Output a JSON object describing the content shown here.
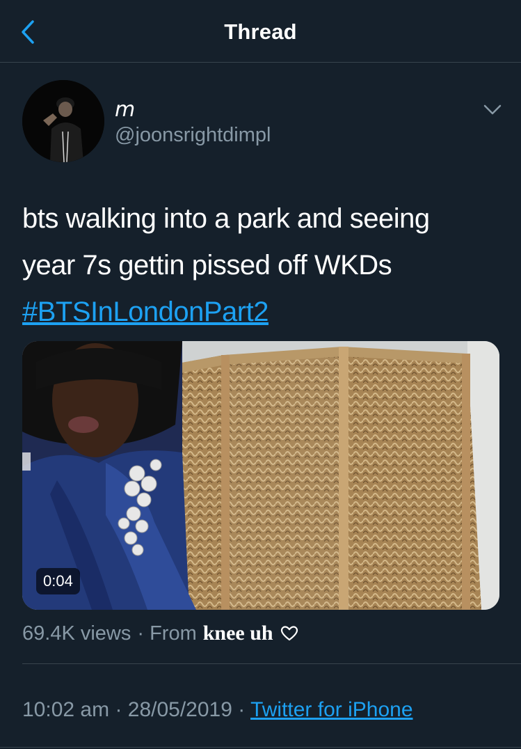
{
  "header": {
    "title": "Thread",
    "back_icon": "chevron-left-icon"
  },
  "colors": {
    "background": "#15202b",
    "accent": "#1da1f2",
    "secondary_text": "#8899a6",
    "divider": "#38444d"
  },
  "tweet": {
    "display_name": "m",
    "handle": "@joonsrightdimpl",
    "text_lines": [
      "bts walking into a park and seeing",
      "year 7s gettin pissed off WKDs"
    ],
    "hashtag": "#BTSInLondonPart2",
    "video": {
      "duration": "0:04"
    },
    "views": "69.4K views",
    "from_label": "· From",
    "from_name": "knee uh",
    "time": "10:02 am",
    "date": "28/05/2019",
    "client": "Twitter for iPhone"
  }
}
